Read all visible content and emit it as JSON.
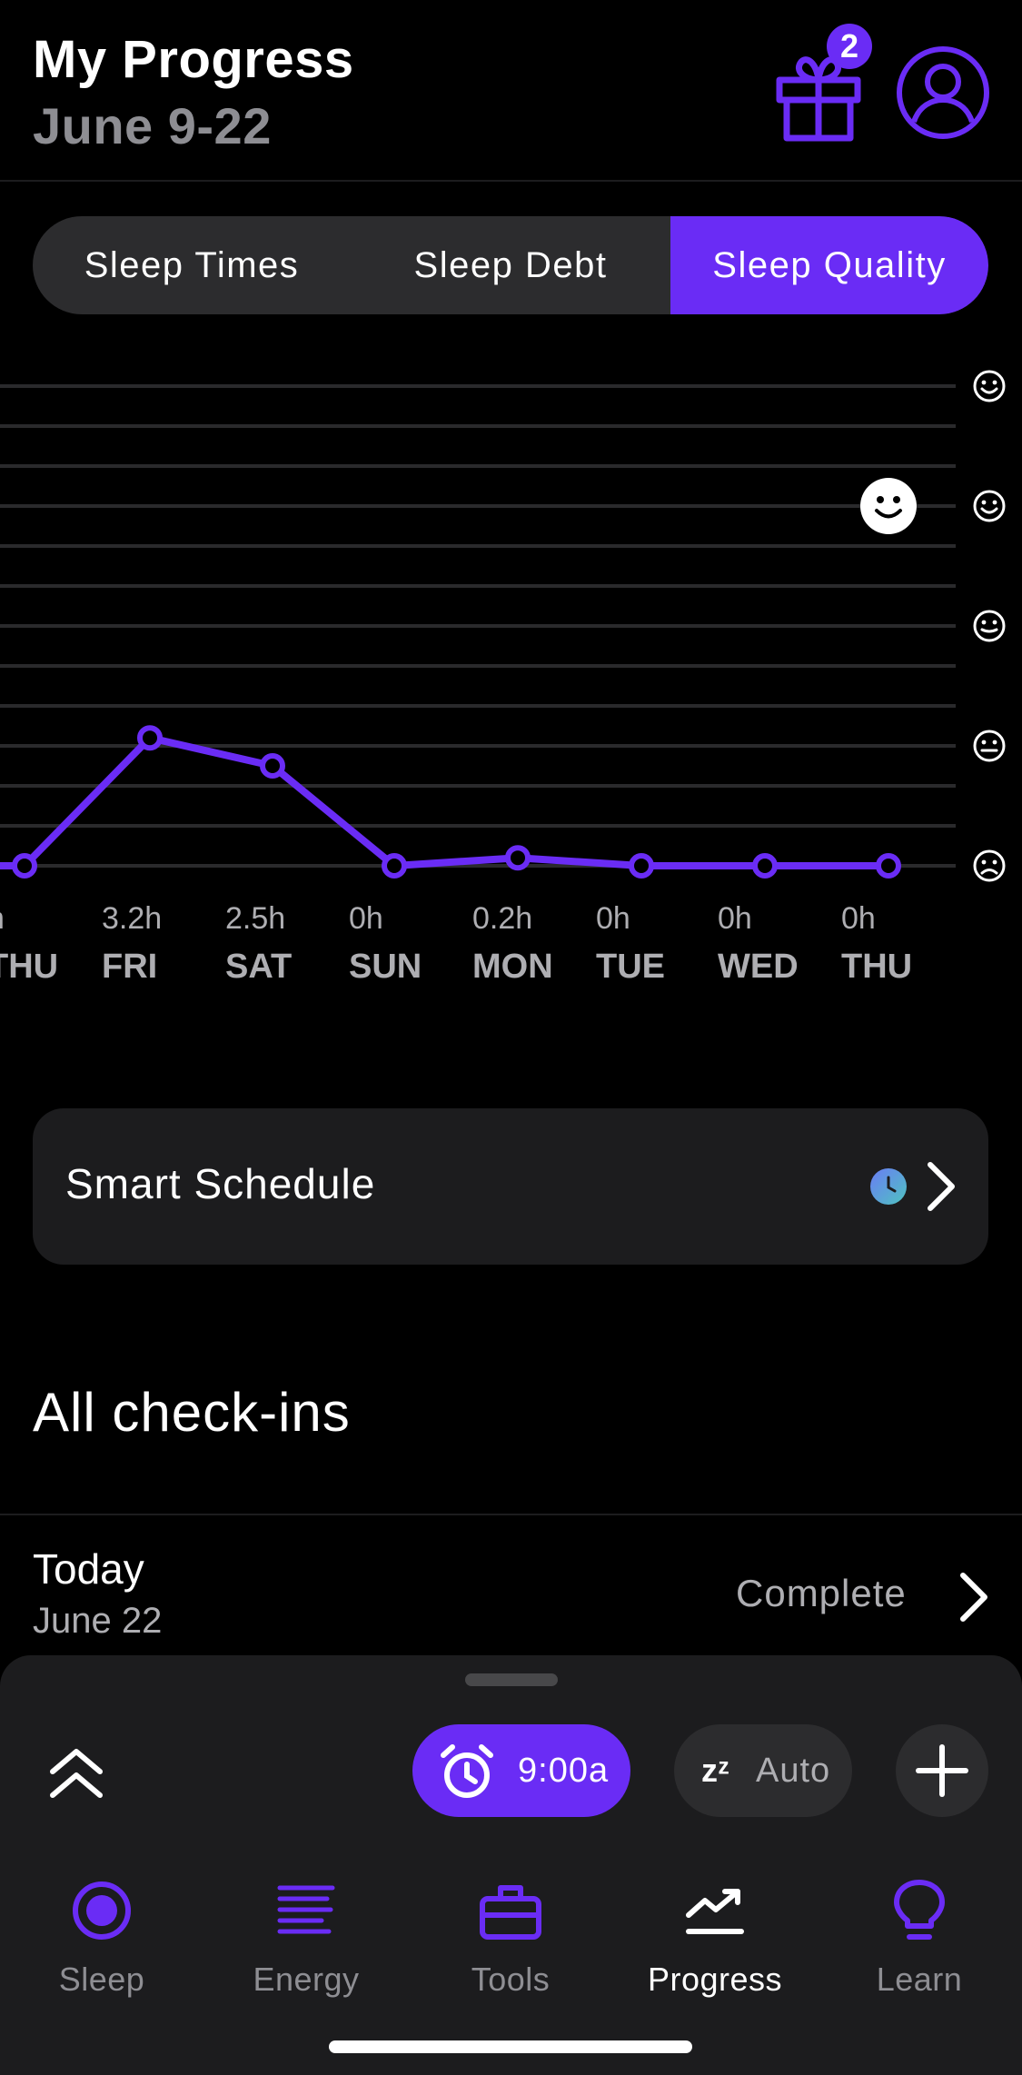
{
  "header": {
    "title": "My Progress",
    "subtitle": "June 9-22",
    "gift_badge": "2"
  },
  "tabs_segment": [
    {
      "label": "Sleep Times",
      "selected": false
    },
    {
      "label": "Sleep Debt",
      "selected": false
    },
    {
      "label": "Sleep Quality",
      "selected": true
    }
  ],
  "chart_data": {
    "type": "line",
    "categories": [
      "THU",
      "FRI",
      "SAT",
      "SUN",
      "MON",
      "TUE",
      "WED",
      "THU"
    ],
    "x_sublabels": [
      "h",
      "3.2h",
      "2.5h",
      "0h",
      "0.2h",
      "0h",
      "0h",
      "0h"
    ],
    "values": [
      0,
      3.2,
      2.5,
      0,
      0.2,
      0,
      0,
      0
    ],
    "ylim": [
      0,
      12
    ],
    "grid": true,
    "y_axis_icons": [
      "happy-face",
      "happy-face",
      "neutral-smile-face",
      "neutral-face",
      "sad-face"
    ],
    "highlight_marker": "happy-face",
    "line_color": "#6a2cf5"
  },
  "smart_schedule": {
    "label": "Smart Schedule"
  },
  "checkins": {
    "title": "All check-ins",
    "rows": [
      {
        "day": "Today",
        "date": "June 22",
        "status": "Complete"
      }
    ]
  },
  "bottom_sheet": {
    "alarm_time": "9:00a",
    "zz": "zᶻ",
    "auto_label": "Auto"
  },
  "nav": [
    {
      "label": "Sleep",
      "icon": "sleep-icon",
      "active": false
    },
    {
      "label": "Energy",
      "icon": "energy-icon",
      "active": false
    },
    {
      "label": "Tools",
      "icon": "toolbox-icon",
      "active": false
    },
    {
      "label": "Progress",
      "icon": "progress-icon",
      "active": true
    },
    {
      "label": "Learn",
      "icon": "lightbulb-icon",
      "active": false
    }
  ],
  "colors": {
    "accent": "#6a2cf5",
    "background": "#000000",
    "card": "#1c1c1e"
  }
}
